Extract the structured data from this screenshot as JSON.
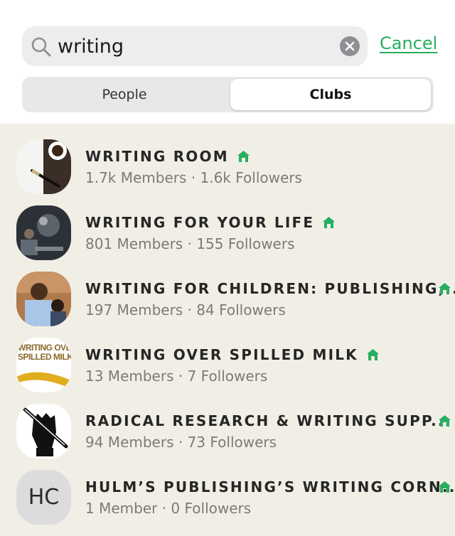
{
  "search": {
    "value": "writing",
    "cancel_label": "Cancel"
  },
  "tabs": {
    "people_label": "People",
    "clubs_label": "Clubs",
    "selected": "Clubs"
  },
  "colors": {
    "accent_green": "#27ae60",
    "background": "#f1efe5"
  },
  "clubs": [
    {
      "name": "WRITING ROOM",
      "stats": "1.7k Members · 1.6k Followers",
      "icon": "house-icon"
    },
    {
      "name": "WRITING FOR YOUR LIFE",
      "stats": "801 Members · 155 Followers",
      "icon": "house-icon"
    },
    {
      "name": "WRITING FOR CHILDREN: PUBLISHING,...",
      "stats": "197 Members · 84 Followers",
      "icon": "house-icon"
    },
    {
      "name": "WRITING OVER SPILLED MILK",
      "stats": "13 Members · 7 Followers",
      "icon": "house-icon",
      "avatar_text": "WRITING OVER SPILLED MILK"
    },
    {
      "name": "RADICAL RESEARCH & WRITING SUPP...",
      "stats": "94 Members · 73 Followers",
      "icon": "house-icon"
    },
    {
      "name": "HULM’S PUBLISHING’S WRITING CORN...",
      "stats": "1 Member · 0 Followers",
      "icon": "house-icon",
      "avatar_text": "HC"
    }
  ]
}
